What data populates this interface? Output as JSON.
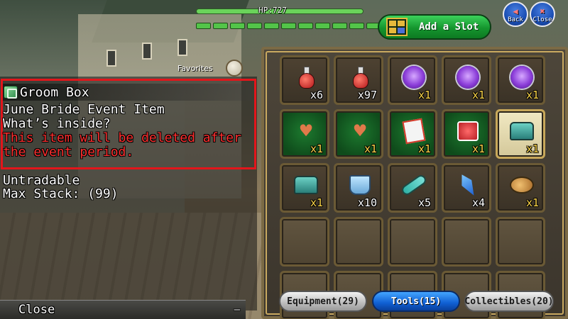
{
  "hud": {
    "hp_label": "HP:727",
    "sp_segments": 12
  },
  "top_buttons": {
    "add_slot": "Add a Slot",
    "back": "Back",
    "close": "Close"
  },
  "favorites_label": "Favorites",
  "item_info": {
    "name": "Groom Box",
    "line1": "June Bride Event Item",
    "line2": "What’s inside?",
    "warning1": "This item will be deleted after",
    "warning2": "the event period.",
    "trade": "Untradable",
    "max_stack": "Max Stack: (99)"
  },
  "close_bar": {
    "label": "Close",
    "collapse": "—"
  },
  "inventory": {
    "slots": [
      {
        "icon": "red-potion-icon",
        "qty": "x6",
        "bg": "normal"
      },
      {
        "icon": "red-potion-icon",
        "qty": "x97",
        "bg": "normal"
      },
      {
        "icon": "purple-doll-icon",
        "qty": "x1",
        "bg": "normal"
      },
      {
        "icon": "purple-doll-icon",
        "qty": "x1",
        "bg": "normal"
      },
      {
        "icon": "purple-doll-icon",
        "qty": "x1",
        "bg": "normal"
      },
      {
        "icon": "heart-cookie-icon",
        "qty": "x1",
        "bg": "green"
      },
      {
        "icon": "heart-cookie-icon",
        "qty": "x1",
        "bg": "green"
      },
      {
        "icon": "card-icon",
        "qty": "x1",
        "bg": "green"
      },
      {
        "icon": "gift-box-icon",
        "qty": "x1",
        "bg": "green"
      },
      {
        "icon": "treasure-chest-icon",
        "qty": "x1",
        "bg": "selected"
      },
      {
        "icon": "treasure-chest-icon",
        "qty": "x1",
        "bg": "normal"
      },
      {
        "icon": "bucket-icon",
        "qty": "x10",
        "bg": "normal"
      },
      {
        "icon": "crossbow-icon",
        "qty": "x5",
        "bg": "normal"
      },
      {
        "icon": "blue-shard-icon",
        "qty": "x4",
        "bg": "normal"
      },
      {
        "icon": "fish-icon",
        "qty": "x1",
        "bg": "normal"
      }
    ],
    "empty_slots": 10
  },
  "tabs": [
    {
      "label": "Equipment(29)",
      "active": false
    },
    {
      "label": "Tools(15)",
      "active": true
    },
    {
      "label": "Collectibles(20)",
      "active": false
    }
  ],
  "colors": {
    "highlight": "#e3151b",
    "warning_text": "#ff2f2f",
    "active_tab": "#0f5fd3",
    "add_slot": "#15952e"
  }
}
